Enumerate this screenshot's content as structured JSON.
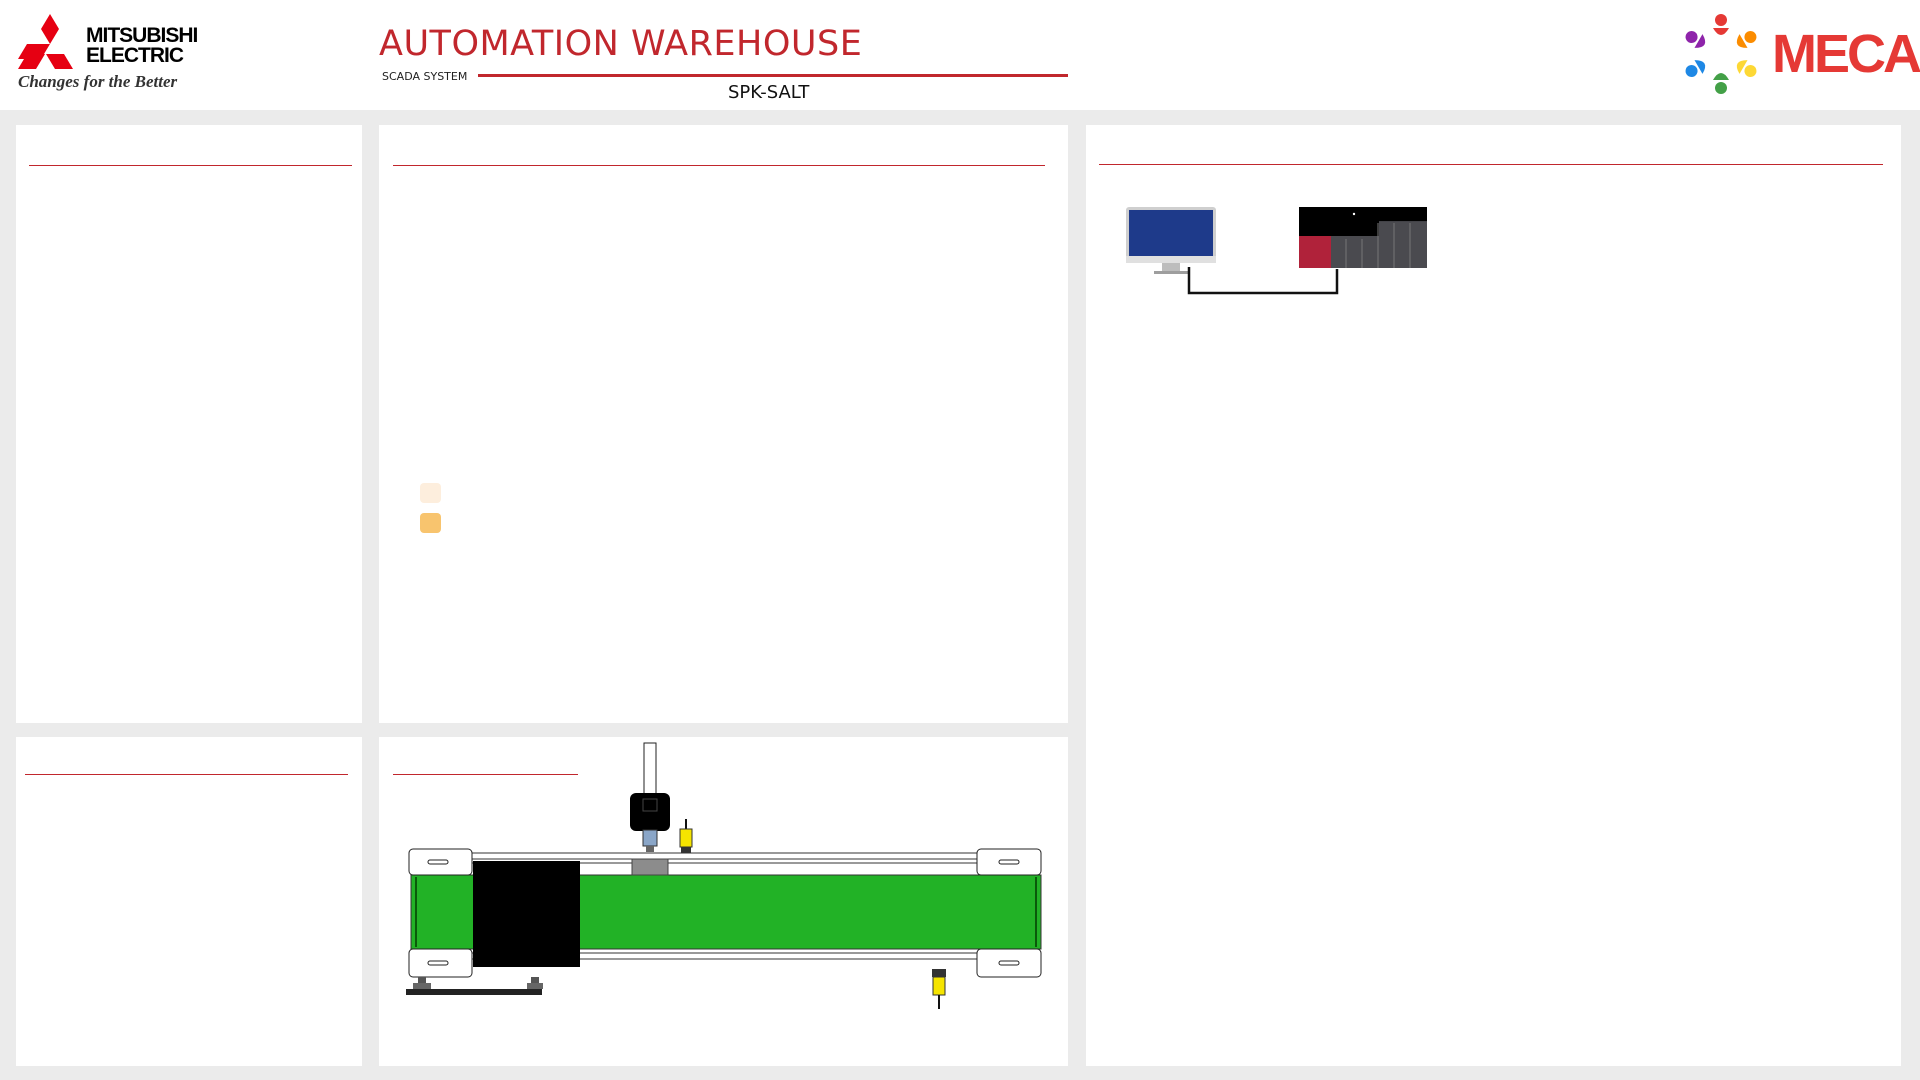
{
  "header": {
    "brand_line1": "MITSUBISHI",
    "brand_line2": "ELECTRIC",
    "slogan": "Changes for the Better",
    "title": "AUTOMATION WAREHOUSE",
    "subtitle": "SCADA SYSTEM",
    "station": "SPK-SALT",
    "partner_logo_text": "MECA"
  },
  "colors": {
    "accent_red": "#c1272d",
    "conveyor_belt": "#22b226",
    "sensor_yellow": "#f5e400",
    "indicator_light": "#fdeedd",
    "indicator_dark": "#f8c46e",
    "monitor_screen": "#1e3a8a",
    "plc_red": "#b0223a"
  },
  "icons": {
    "brand": "mitsubishi-diamond-logo",
    "partner": "meca-flower-logo",
    "computer": "desktop-monitor-icon",
    "plc": "plc-rack-icon"
  }
}
